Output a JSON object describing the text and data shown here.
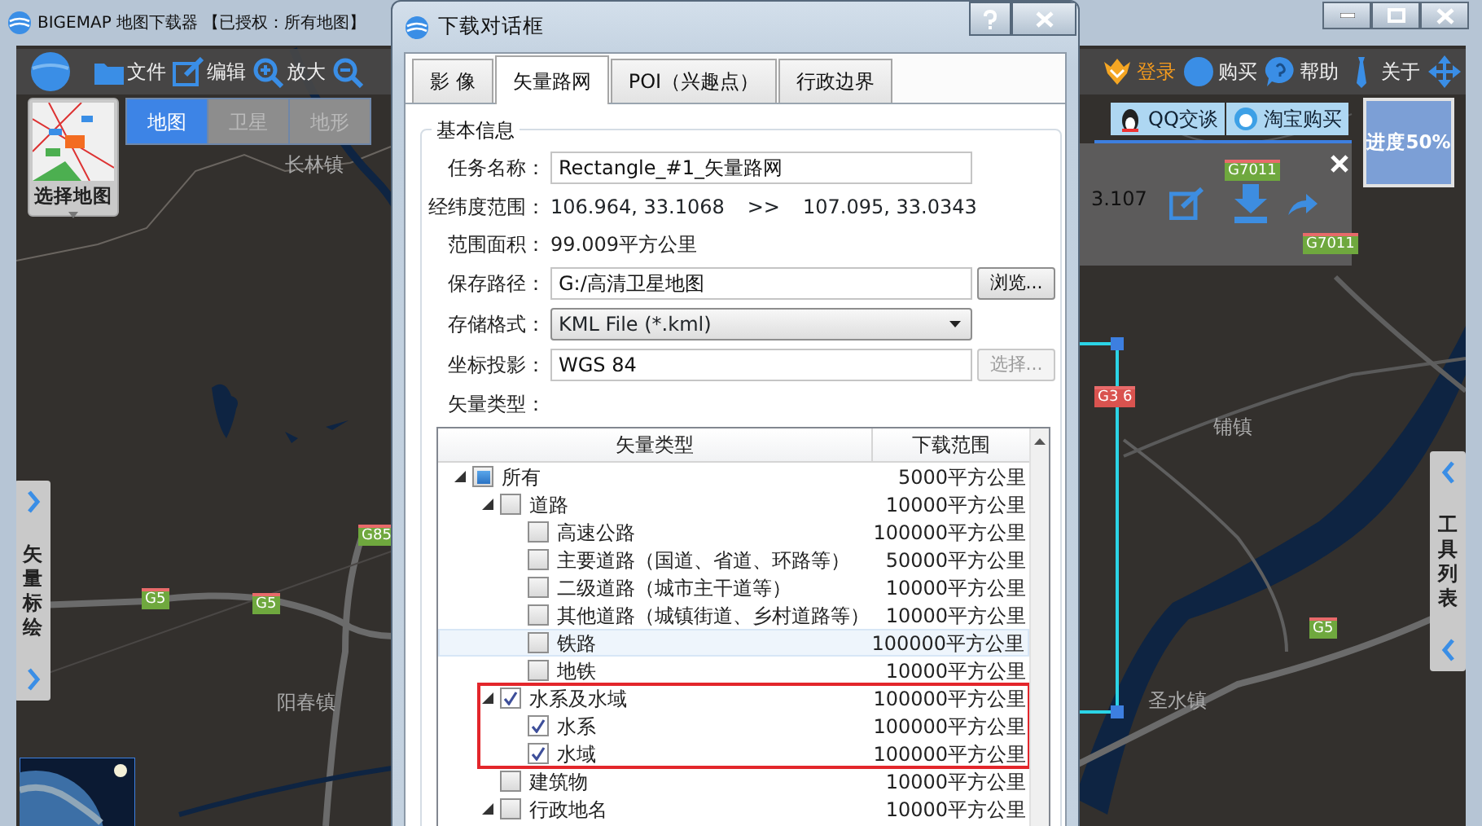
{
  "main_window": {
    "title": "BIGEMAP 地图下载器 【已授权：所有地图】"
  },
  "toolbar": {
    "left": [
      {
        "label": "文件"
      },
      {
        "label": "编辑"
      },
      {
        "label": "放大"
      }
    ],
    "right": [
      {
        "label": "登录",
        "highlighted": true
      },
      {
        "label": "购买",
        "highlighted": false
      },
      {
        "label": "帮助",
        "highlighted": false
      },
      {
        "label": "关于",
        "highlighted": false
      }
    ]
  },
  "map_selector": {
    "label": "选择地图",
    "tabs": [
      {
        "label": "地图",
        "selected": true
      },
      {
        "label": "卫星",
        "selected": false
      },
      {
        "label": "地形",
        "selected": false
      }
    ]
  },
  "map": {
    "places": [
      "长林镇",
      "阳春镇",
      "铺镇",
      "圣水镇"
    ],
    "shields": [
      {
        "label": "G85",
        "color": "#6fa83e"
      },
      {
        "label": "G5",
        "color": "#6fa83e"
      },
      {
        "label": "G5",
        "color": "#6fa83e"
      },
      {
        "label": "G5",
        "color": "#6fa83e"
      },
      {
        "label": "G7011",
        "color": "#6fa83e"
      },
      {
        "label": "G7011",
        "color": "#6fa83e"
      },
      {
        "label": "G3 6",
        "color": "#d9534f"
      }
    ]
  },
  "side_panels": {
    "left": {
      "label": "矢量标绘"
    },
    "right": {
      "label": "工具列表"
    }
  },
  "quick_buttons": [
    {
      "label": "QQ交谈"
    },
    {
      "label": "淘宝购买"
    }
  ],
  "progress": {
    "label": "进度50%"
  },
  "info_panel": {
    "coordinate": "3.107"
  },
  "dialog": {
    "title": "下载对话框",
    "tabs": [
      {
        "label": "影 像",
        "selected": false
      },
      {
        "label": "矢量路网",
        "selected": true
      },
      {
        "label": "POI（兴趣点）",
        "selected": false
      },
      {
        "label": "行政边界",
        "selected": false
      }
    ],
    "group_title": "基本信息",
    "fields": [
      {
        "kind": "input",
        "label": "任务名称：",
        "value": "Rectangle_#1_矢量路网"
      },
      {
        "kind": "range",
        "label": "经纬度范围：",
        "from": "106.964, 33.1068",
        "separator": ">>",
        "to": "107.095, 33.0343"
      },
      {
        "kind": "text",
        "label": "范围面积：",
        "value": "99.009平方公里"
      },
      {
        "kind": "input",
        "label": "保存路径：",
        "value": "G:/高清卫星地图",
        "button": {
          "label": "浏览...",
          "disabled": false
        }
      },
      {
        "kind": "select",
        "label": "存储格式：",
        "value": "KML File (*.kml)"
      },
      {
        "kind": "input",
        "label": "坐标投影：",
        "value": "WGS 84",
        "button": {
          "label": "选择...",
          "disabled": true
        }
      },
      {
        "kind": "heading",
        "label": "矢量类型："
      }
    ],
    "tree": {
      "columns": [
        "矢量类型",
        "下载范围"
      ],
      "items": [
        {
          "label": "所有",
          "range": "5000平方公里",
          "checked": false,
          "indeterminate": true,
          "expanded": true,
          "children": [
            {
              "label": "道路",
              "range": "10000平方公里",
              "checked": false,
              "expanded": true,
              "children": [
                {
                  "label": "高速公路",
                  "range": "100000平方公里",
                  "checked": false,
                  "hovered": false
                },
                {
                  "label": "主要道路（国道、省道、环路等）",
                  "range": "50000平方公里",
                  "checked": false,
                  "hovered": false
                },
                {
                  "label": "二级道路（城市主干道等）",
                  "range": "10000平方公里",
                  "checked": false,
                  "hovered": false
                },
                {
                  "label": "其他道路（城镇街道、乡村道路等）",
                  "range": "10000平方公里",
                  "checked": false,
                  "hovered": false
                },
                {
                  "label": "铁路",
                  "range": "100000平方公里",
                  "checked": false,
                  "hovered": true
                },
                {
                  "label": "地铁",
                  "range": "10000平方公里",
                  "checked": false,
                  "hovered": false
                }
              ]
            },
            {
              "label": "水系及水域",
              "range": "100000平方公里",
              "checked": true,
              "expanded": true,
              "outlined": true,
              "children": [
                {
                  "label": "水系",
                  "range": "100000平方公里",
                  "checked": true
                },
                {
                  "label": "水域",
                  "range": "100000平方公里",
                  "checked": true
                }
              ]
            },
            {
              "label": "建筑物",
              "range": "10000平方公里",
              "checked": false
            },
            {
              "label": "行政地名",
              "range": "10000平方公里",
              "checked": false,
              "expanded": true
            }
          ]
        }
      ]
    }
  }
}
